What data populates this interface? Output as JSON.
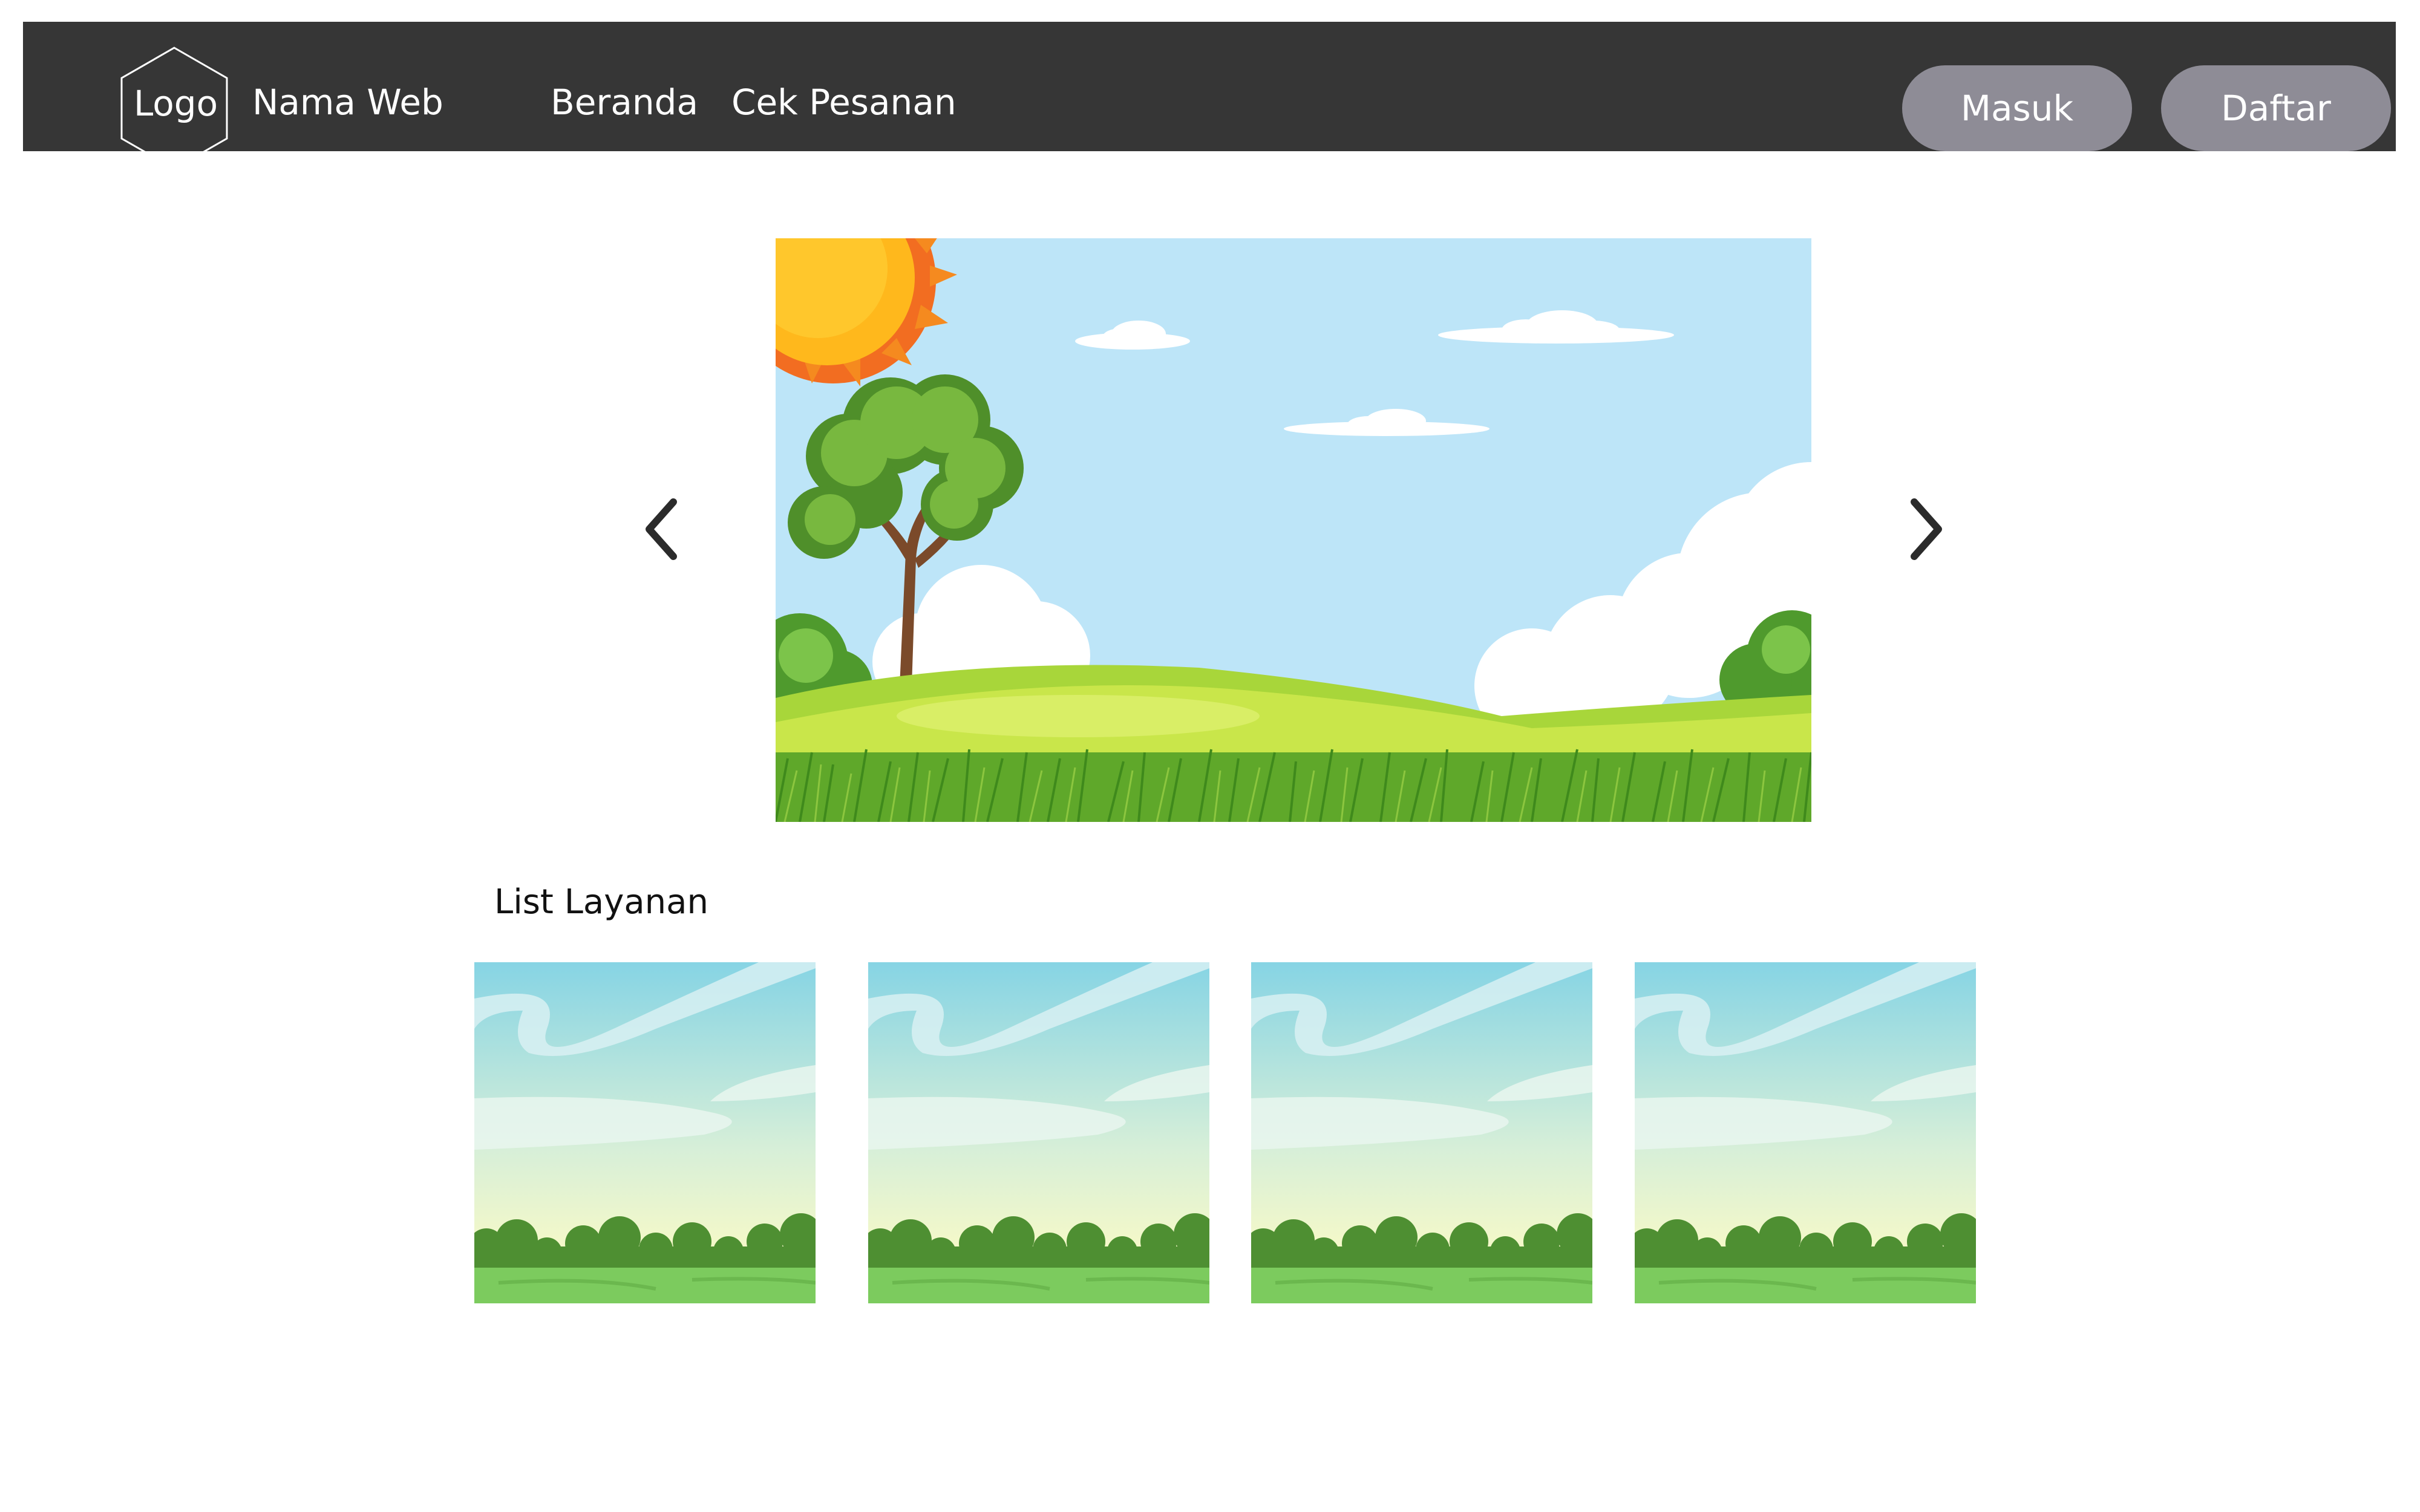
{
  "header": {
    "logo_label": "Logo",
    "site_name": "Nama Web",
    "nav": [
      {
        "label": "Beranda"
      },
      {
        "label": "Cek Pesanan"
      }
    ],
    "login_label": "Masuk",
    "register_label": "Daftar"
  },
  "carousel": {
    "prev_icon": "chevron-left-icon",
    "next_icon": "chevron-right-icon",
    "image": "landscape-illustration"
  },
  "services": {
    "title": "List Layanan",
    "items": [
      {
        "image": "landscape-thumbnail"
      },
      {
        "image": "landscape-thumbnail"
      },
      {
        "image": "landscape-thumbnail"
      },
      {
        "image": "landscape-thumbnail"
      }
    ]
  },
  "colors": {
    "navbar": "#363636",
    "button": "#8e8c96",
    "sky": "#bde5f8",
    "grass": "#7cc44a"
  }
}
